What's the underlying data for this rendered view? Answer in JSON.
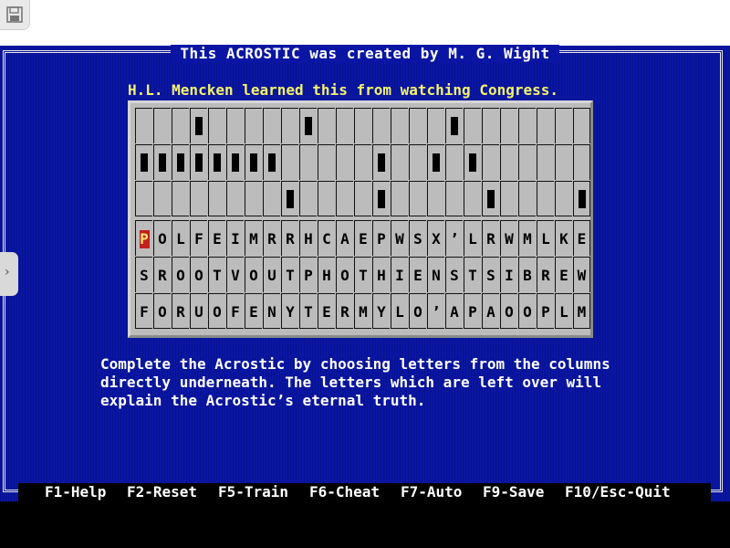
{
  "title": "This ACROSTIC was created by M. G. Wight",
  "quote": "H.L. Mencken learned this from watching Congress.",
  "puzzle": {
    "columns": 25,
    "top_rows": 3,
    "top_blocks": [
      [
        3,
        9,
        17
      ],
      [
        0,
        1,
        2,
        3,
        4,
        5,
        6,
        7,
        13,
        16,
        18
      ],
      [
        8,
        13,
        19,
        24
      ]
    ],
    "letters": [
      [
        "P",
        "O",
        "L",
        "F",
        "E",
        "I",
        "M",
        "R",
        "R",
        "H",
        "C",
        "A",
        "E",
        "P",
        "W",
        "S",
        "X",
        "’",
        "L",
        "R",
        "W",
        "M",
        "L",
        "K",
        "E"
      ],
      [
        "S",
        "R",
        "O",
        "O",
        "T",
        "V",
        "O",
        "U",
        "T",
        "P",
        "H",
        "O",
        "T",
        "H",
        "I",
        "E",
        "N",
        "S",
        "T",
        "S",
        "I",
        "B",
        "R",
        "E",
        "W"
      ],
      [
        "F",
        "O",
        "R",
        "U",
        "O",
        "F",
        "E",
        "N",
        "Y",
        "T",
        "E",
        "R",
        "M",
        "Y",
        "L",
        "O",
        "’",
        "A",
        "P",
        "A",
        "O",
        "O",
        "P",
        "L",
        "M"
      ]
    ],
    "selected": [
      0,
      0
    ]
  },
  "instructions": [
    "Complete the Acrostic by choosing letters from the columns",
    "directly underneath. The letters which are left over will",
    "explain the Acrostic’s eternal truth."
  ],
  "fkeys": [
    "F1-Help",
    "F2-Reset",
    "F5-Train",
    "F6-Cheat",
    "F7-Auto",
    "F9-Save",
    "F10/Esc-Quit"
  ],
  "icons": {
    "save": "floppy-disk-icon",
    "side": "chevron-right-icon"
  },
  "colors": {
    "background": "#0a16a3",
    "quote": "#f3f36b",
    "board": "#bcbcbc",
    "selected_bg": "#c41f1f",
    "selected_fg": "#ffe66a"
  }
}
